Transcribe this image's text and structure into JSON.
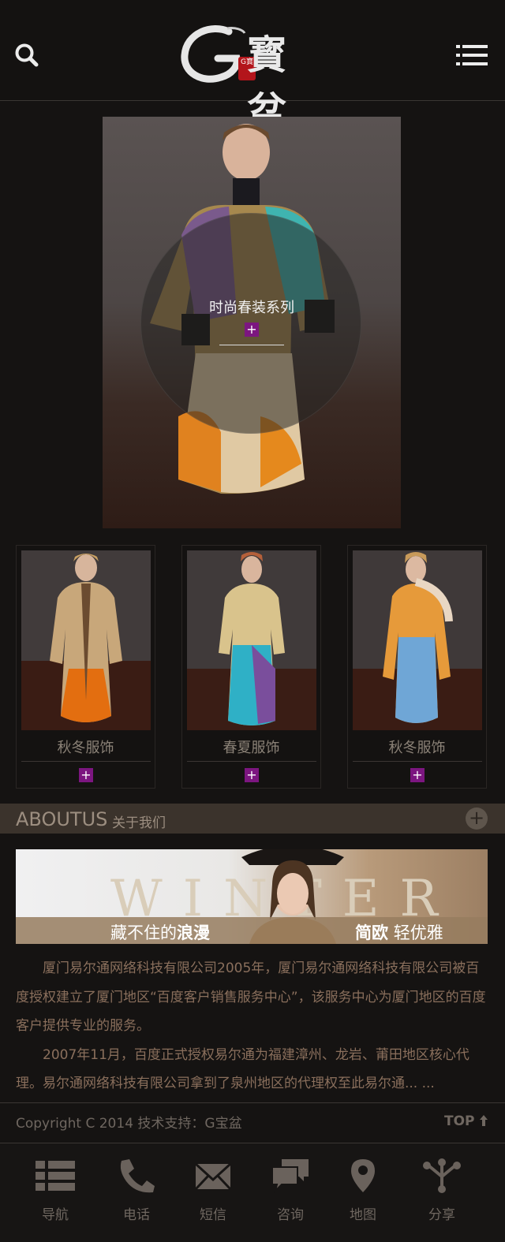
{
  "header": {
    "logo_text": "寳盆",
    "logo_seal": "G寶",
    "search_icon": "search-icon",
    "menu_icon": "menu-icon"
  },
  "hero": {
    "title": "时尚春装系列",
    "plus": "+"
  },
  "products": [
    {
      "label": "秋冬服饰",
      "plus": "+"
    },
    {
      "label": "春夏服饰",
      "plus": "+"
    },
    {
      "label": "秋冬服饰",
      "plus": "+"
    }
  ],
  "about": {
    "title_en": "ABOUTUS",
    "title_cn": "关于我们",
    "more": "+",
    "banner": {
      "winter": "WINTER",
      "slogan_left_normal": "藏不住的",
      "slogan_left_bold": "浪漫",
      "slogan_right_bold": "简欧",
      "slogan_right_normal": "轻优雅"
    },
    "paragraphs": [
      "厦门易尔通网络科技有限公司2005年，厦门易尔通网络科技有限公司被百度授权建立了厦门地区“百度客户销售服务中心”，该服务中心为厦门地区的百度客户提供专业的服务。",
      "2007年11月，百度正式授权易尔通为福建漳州、龙岩、莆田地区核心代理。易尔通网络科技有限公司拿到了泉州地区的代理权至此易尔通... ..."
    ]
  },
  "footer": {
    "copyright": "Copyright C 2014 技术支持：G宝盆",
    "top": "TOP"
  },
  "bottom_nav": [
    {
      "label": "导航",
      "icon": "list-icon"
    },
    {
      "label": "电话",
      "icon": "phone-icon"
    },
    {
      "label": "短信",
      "icon": "envelope-icon"
    },
    {
      "label": "咨询",
      "icon": "chat-icon"
    },
    {
      "label": "地图",
      "icon": "map-pin-icon"
    },
    {
      "label": "分享",
      "icon": "share-icon"
    }
  ],
  "colors": {
    "background": "#151312",
    "accent_plus": "#7c1680",
    "about_bar": "#3b332c",
    "about_text": "#8a6f5c"
  }
}
